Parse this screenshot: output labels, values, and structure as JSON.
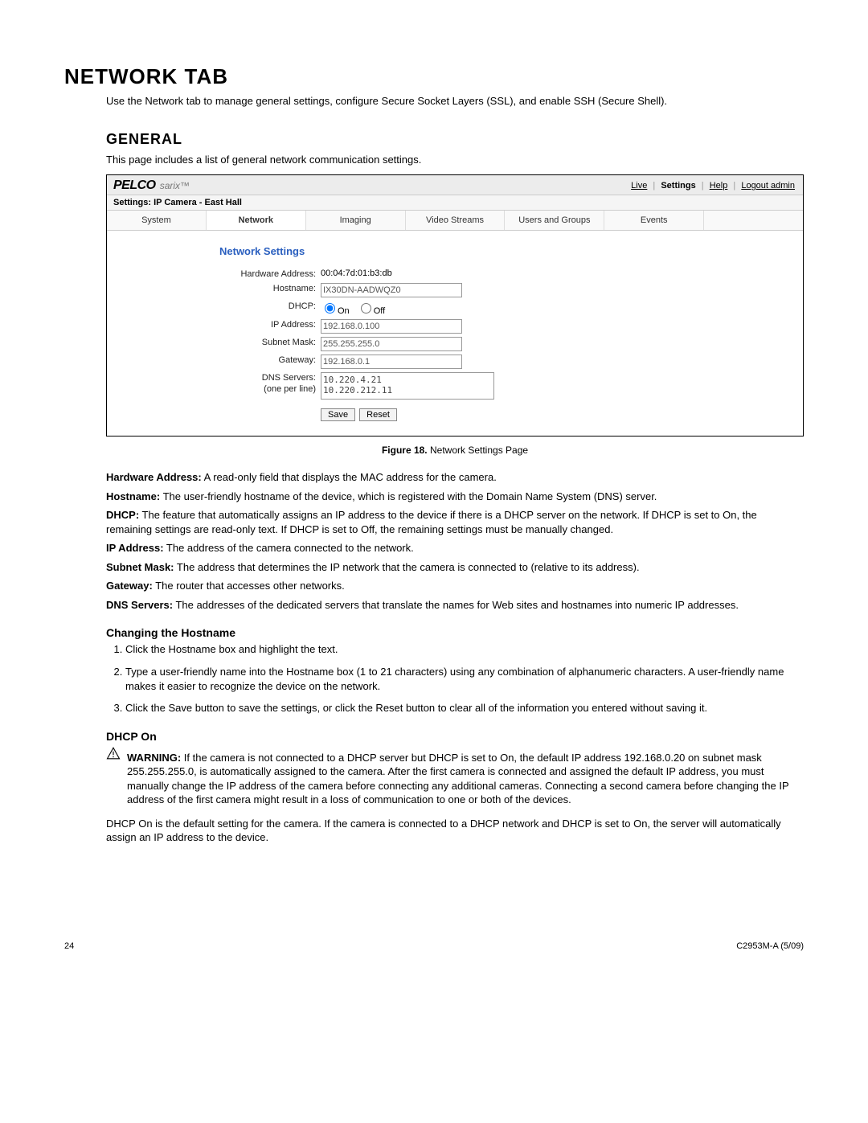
{
  "page": {
    "title": "NETWORK TAB",
    "intro": "Use the Network tab to manage general settings, configure Secure Socket Layers (SSL), and enable SSH (Secure Shell).",
    "general_heading": "GENERAL",
    "general_intro": "This page includes a list of general network communication settings.",
    "figure_label": "Figure 18.",
    "figure_caption": "Network Settings Page",
    "footer_left": "24",
    "footer_right": "C2953M-A (5/09)"
  },
  "shot": {
    "brand": "PELCO",
    "brand_sub": "sarix™",
    "links": {
      "live": "Live",
      "settings": "Settings",
      "help": "Help",
      "logout": "Logout admin"
    },
    "crumb": "Settings: IP Camera - East Hall",
    "tabs": [
      "System",
      "Network",
      "Imaging",
      "Video Streams",
      "Users and Groups",
      "Events",
      ""
    ],
    "active_tab": "Network",
    "panel_title": "Network Settings",
    "fields": {
      "hw_addr_label": "Hardware Address:",
      "hw_addr_value": "00:04:7d:01:b3:db",
      "hostname_label": "Hostname:",
      "hostname_value": "IX30DN-AADWQZ0",
      "dhcp_label": "DHCP:",
      "dhcp_on": "On",
      "dhcp_off": "Off",
      "ip_label": "IP Address:",
      "ip_value": "192.168.0.100",
      "subnet_label": "Subnet Mask:",
      "subnet_value": "255.255.255.0",
      "gateway_label": "Gateway:",
      "gateway_value": "192.168.0.1",
      "dns_label": "DNS Servers:\n(one per line)",
      "dns_value": "10.220.4.21\n10.220.212.11",
      "save": "Save",
      "reset": "Reset"
    }
  },
  "defs": {
    "hw_label": "Hardware Address:",
    "hw_text": " A read-only field that displays the MAC address for the camera.",
    "host_label": "Hostname:",
    "host_text": " The user-friendly hostname of the device, which is registered with the Domain Name System (DNS) server.",
    "dhcp_label": "DHCP:",
    "dhcp_text": " The feature that automatically assigns an IP address to the device if there is a DHCP server on the network. If DHCP is set to On, the remaining settings are read-only text. If DHCP is set to Off, the remaining settings must be manually changed.",
    "ip_label": "IP Address:",
    "ip_text": " The address of the camera connected to the network.",
    "subnet_label": "Subnet Mask:",
    "subnet_text": " The address that determines the IP network that the camera is connected to (relative to its address).",
    "gw_label": "Gateway:",
    "gw_text": " The router that accesses other networks.",
    "dns_label": "DNS Servers:",
    "dns_text": " The addresses of the dedicated servers that translate the names for Web sites and hostnames into numeric IP addresses."
  },
  "hostname_section": {
    "heading": "Changing the Hostname",
    "steps": [
      "Click the Hostname box and highlight the text.",
      "Type a user-friendly name into the Hostname box (1 to 21 characters) using any combination of alphanumeric characters. A user-friendly name makes it easier to recognize the device on the network.",
      "Click the Save button to save the settings, or click the Reset button to clear all of the information you entered without saving it."
    ]
  },
  "dhcp_section": {
    "heading": "DHCP On",
    "warning_label": "WARNING:",
    "warning_text": "  If the camera is not connected to a DHCP server but DHCP is set to On, the default IP address 192.168.0.20 on subnet mask 255.255.255.0, is automatically assigned to the camera. After the first camera is connected and assigned the default IP address, you must manually change the IP address of the camera before connecting any additional cameras. Connecting a second camera before changing the IP address of the first camera might result in a loss of communication to one or both of the devices.",
    "para": "DHCP On is the default setting for the camera. If the camera is connected to a DHCP network and DHCP is set to On, the server will automatically assign an IP address to the device."
  }
}
